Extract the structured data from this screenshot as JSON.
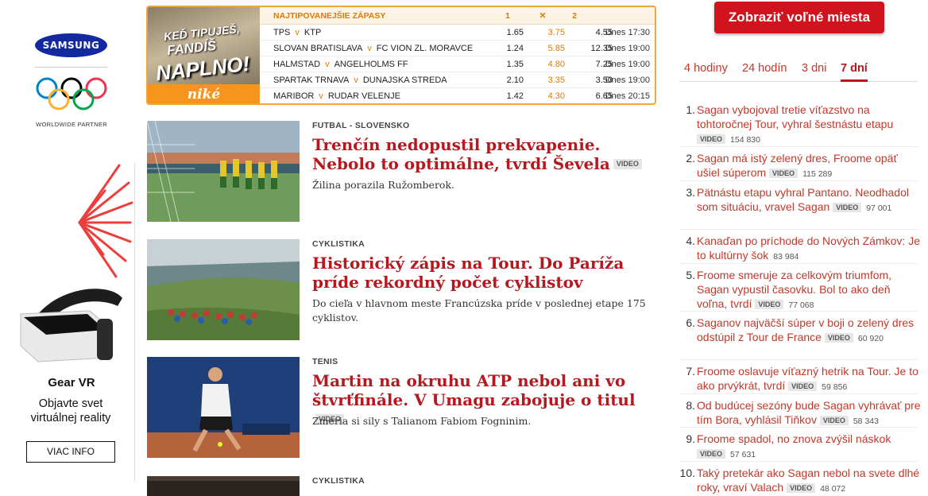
{
  "ad": {
    "brand": "SAMSUNG",
    "partner": "WORLDWIDE PARTNER",
    "product": "Gear VR",
    "subtitle_line1": "Objavte svet",
    "subtitle_line2": "virtuálnej reality",
    "cta": "VIAC INFO"
  },
  "odds": {
    "image_line1": "KEĎ TIPUJEŠ,",
    "image_line2": "FANDÍŠ",
    "image_line3": "NAPLNO!",
    "image_brand": "niké",
    "header": {
      "title": "NAJTIPOVANEJŠIE ZÁPASY",
      "c1": "1",
      "cx": "✕",
      "c2": "2"
    },
    "rows": [
      {
        "home": "TPS",
        "away": "KTP",
        "o1": "1.65",
        "ox": "3.75",
        "o2": "4.55",
        "time": "Dnes 17:30"
      },
      {
        "home": "SLOVAN BRATISLAVA",
        "away": "FC VION ZL. MORAVCE",
        "o1": "1.24",
        "ox": "5.85",
        "o2": "12.35",
        "time": "Dnes 19:00"
      },
      {
        "home": "HALMSTAD",
        "away": "ANGELHOLMS FF",
        "o1": "1.35",
        "ox": "4.80",
        "o2": "7.25",
        "time": "Dnes 19:00"
      },
      {
        "home": "SPARTAK TRNAVA",
        "away": "DUNAJSKA STREDA",
        "o1": "2.10",
        "ox": "3.35",
        "o2": "3.50",
        "time": "Dnes 19:00"
      },
      {
        "home": "MARIBOR",
        "away": "RUDAR VELENJE",
        "o1": "1.42",
        "ox": "4.30",
        "o2": "6.65",
        "time": "Dnes 20:15"
      }
    ],
    "vs": "v"
  },
  "articles": [
    {
      "category": "FUTBAL - SLOVENSKO",
      "title": "Trenčín nedopustil prekvapenie. Nebolo to optimálne, tvrdí Ševela",
      "badge": "VIDEO",
      "perex": "Žilina porazila Ružomberok."
    },
    {
      "category": "CYKLISTIKA",
      "title": "Historický zápis na Tour. Do Paríža príde rekordný počet cyklistov",
      "badge": "",
      "perex": "Do cieľa v hlavnom meste Francúzska príde v poslednej etape 175 cyklistov."
    },
    {
      "category": "TENIS",
      "title": "Martin na okruhu ATP nebol ani vo štvrťfinále. V Umagu zabojuje o titul",
      "badge": "VIDEO",
      "perex": "Zmeria si sily s Talianom Fabiom Fogninim."
    },
    {
      "category": "CYKLISTIKA",
      "title": "",
      "badge": "",
      "perex": ""
    }
  ],
  "sidebar": {
    "cta": "Zobraziť voľné miesta",
    "tabs": [
      "4 hodiny",
      "24 hodín",
      "3 dni",
      "7 dní"
    ],
    "active_tab": "7 dní",
    "ranking": [
      {
        "n": "1.",
        "title": "Sagan vybojoval tretie víťazstvo na tohtoročnej Tour, vyhral šestnástu etapu",
        "badge": "VIDEO",
        "views": "154 830"
      },
      {
        "n": "2.",
        "title": "Sagan má istý zelený dres, Froome opäť ušiel súperom",
        "badge": "VIDEO",
        "views": "115 289"
      },
      {
        "n": "3.",
        "title": "Pätnástu etapu vyhral Pantano. Neodhadol som situáciu, vravel Sagan",
        "badge": "VIDEO",
        "views": "97 001"
      },
      {
        "n": "4.",
        "title": "Kanaďan po príchode do Nových Zámkov: Je to kultúrny šok",
        "badge": "",
        "views": "83 984"
      },
      {
        "n": "5.",
        "title": "Froome smeruje za celkovým triumfom, Sagan vypustil časovku. Bol to ako deň voľna, tvrdí",
        "badge": "VIDEO",
        "views": "77 068"
      },
      {
        "n": "6.",
        "title": "Saganov najväčší súper v boji o zelený dres odstúpil z Tour de France",
        "badge": "VIDEO",
        "views": "60 920"
      },
      {
        "n": "7.",
        "title": "Froome oslavuje víťazný hetrik na Tour. Je to ako prvýkrát, tvrdí",
        "badge": "VIDEO",
        "views": "59 856"
      },
      {
        "n": "8.",
        "title": "Od budúcej sezóny bude Sagan vyhrávať pre tím Bora, vyhlásil Tiňkov",
        "badge": "VIDEO",
        "views": "58 343"
      },
      {
        "n": "9.",
        "title": "Froome spadol, no znova zvýšil náskok",
        "badge": "VIDEO",
        "views": "57 631"
      },
      {
        "n": "10.",
        "title": "Taký pretekár ako Sagan nebol na svete dlhé roky, vraví Valach",
        "badge": "VIDEO",
        "views": "48 072"
      }
    ]
  }
}
